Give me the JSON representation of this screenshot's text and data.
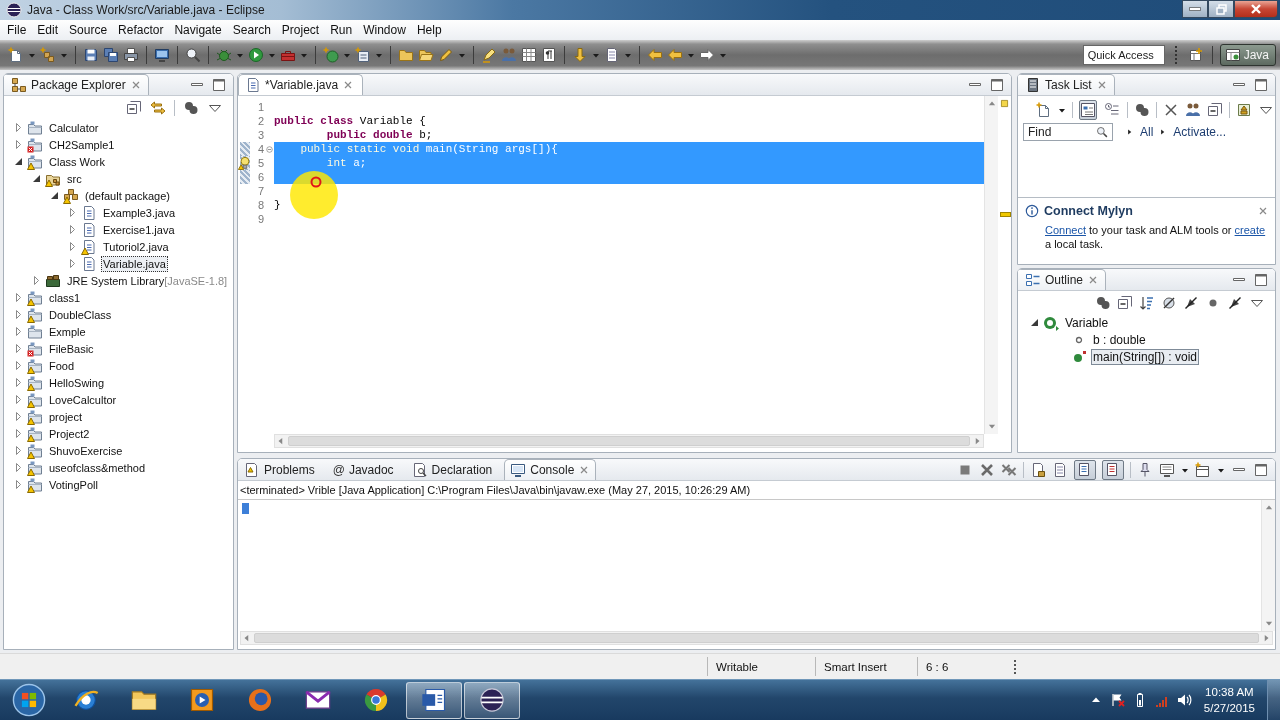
{
  "window": {
    "title": "Java - Class Work/src/Variable.java - Eclipse"
  },
  "menu": [
    "File",
    "Edit",
    "Source",
    "Refactor",
    "Navigate",
    "Search",
    "Project",
    "Run",
    "Window",
    "Help"
  ],
  "toolbar": {
    "quick_access": {
      "placeholder": "Quick Access"
    },
    "perspective": {
      "label": "Java",
      "selected": true
    }
  },
  "package_explorer": {
    "title": "Package Explorer",
    "tree": [
      {
        "label": "Calculator",
        "kind": "project",
        "warning": false,
        "error": false,
        "expanded": false,
        "selected": false
      },
      {
        "label": "CH2Sample1",
        "kind": "project",
        "warning": false,
        "error": true,
        "expanded": false,
        "selected": false
      },
      {
        "label": "Class Work",
        "kind": "project",
        "warning": true,
        "error": false,
        "expanded": true,
        "selected": false,
        "children": [
          {
            "label": "src",
            "kind": "source",
            "warning": true,
            "error": false,
            "expanded": true,
            "selected": false,
            "children": [
              {
                "label": "(default package)",
                "kind": "package",
                "warning": true,
                "error": false,
                "expanded": true,
                "selected": false,
                "children": [
                  {
                    "label": "Example3.java",
                    "kind": "file",
                    "warning": false,
                    "error": false,
                    "expanded": false,
                    "selected": false
                  },
                  {
                    "label": "Exercise1.java",
                    "kind": "file",
                    "warning": false,
                    "error": false,
                    "expanded": false,
                    "selected": false
                  },
                  {
                    "label": "Tutoriol2.java",
                    "kind": "file",
                    "warning": true,
                    "error": false,
                    "expanded": false,
                    "selected": false
                  },
                  {
                    "label": "Variable.java",
                    "kind": "file",
                    "warning": false,
                    "error": false,
                    "expanded": false,
                    "selected": true
                  }
                ]
              }
            ]
          },
          {
            "label": "JRE System Library",
            "suffix": "[JavaSE-1.8]",
            "kind": "library",
            "warning": false,
            "error": false,
            "expanded": false,
            "selected": false
          }
        ]
      },
      {
        "label": "class1",
        "kind": "project",
        "warning": true,
        "error": false,
        "expanded": false,
        "selected": false
      },
      {
        "label": "DoubleClass",
        "kind": "project",
        "warning": true,
        "error": false,
        "expanded": false,
        "selected": false
      },
      {
        "label": "Exmple",
        "kind": "project",
        "warning": false,
        "error": false,
        "expanded": false,
        "selected": false
      },
      {
        "label": "FileBasic",
        "kind": "project",
        "warning": false,
        "error": true,
        "expanded": false,
        "selected": false
      },
      {
        "label": "Food",
        "kind": "project",
        "warning": true,
        "error": false,
        "expanded": false,
        "selected": false
      },
      {
        "label": "HelloSwing",
        "kind": "project",
        "warning": true,
        "error": false,
        "expanded": false,
        "selected": false
      },
      {
        "label": "LoveCalcultor",
        "kind": "project",
        "warning": true,
        "error": false,
        "expanded": false,
        "selected": false
      },
      {
        "label": "project",
        "kind": "project",
        "warning": true,
        "error": false,
        "expanded": false,
        "selected": false
      },
      {
        "label": "Project2",
        "kind": "project",
        "warning": true,
        "error": false,
        "expanded": false,
        "selected": false
      },
      {
        "label": "ShuvoExercise",
        "kind": "project",
        "warning": true,
        "error": false,
        "expanded": false,
        "selected": false
      },
      {
        "label": "useofclass&method",
        "kind": "project",
        "warning": true,
        "error": false,
        "expanded": false,
        "selected": false
      },
      {
        "label": "VotingPoll",
        "kind": "project",
        "warning": true,
        "error": false,
        "expanded": false,
        "selected": false
      }
    ]
  },
  "editor": {
    "tabs": [
      {
        "label": "*Variable.java",
        "selected": true
      }
    ],
    "lines": [
      {
        "number": "1",
        "selected": false
      },
      {
        "number": "2",
        "code": "**public** **class** Variable {",
        "selected": false
      },
      {
        "number": "3",
        "code": "        **public** **double** b;",
        "selected": false
      },
      {
        "number": "4",
        "code": "    **public** **static** **void** main(String args[]){",
        "selected": true,
        "fold": true
      },
      {
        "number": "5",
        "code": "        **int** a;",
        "selected": true,
        "quick_fix": true
      },
      {
        "number": "6",
        "selected": true
      },
      {
        "number": "7",
        "selected": false
      },
      {
        "number": "8",
        "code": "}",
        "selected": false
      },
      {
        "number": "9",
        "selected": false
      }
    ]
  },
  "task_list": {
    "title": "Task List",
    "toggles": [
      {
        "kind": "categorized",
        "selected": true
      },
      {
        "kind": "scheduled",
        "selected": false
      }
    ],
    "find": {
      "placeholder": "Find"
    },
    "filters": [
      "All",
      "Activate..."
    ]
  },
  "mylyn": {
    "title": "Connect Mylyn",
    "message": [
      {
        "text": "Connect",
        "link": true
      },
      {
        "text": "to your task and ALM tools or",
        "link": false
      },
      {
        "text": "create",
        "link": true
      },
      {
        "text": "a local task.",
        "link": false
      }
    ]
  },
  "outline": {
    "title": "Outline",
    "tree": [
      {
        "label": "Variable",
        "kind": "class",
        "expanded": true,
        "selected": false,
        "children": [
          {
            "label": "b : double",
            "kind": "field",
            "selected": false
          },
          {
            "label": "main(String[]) : void",
            "kind": "method",
            "selected": true
          }
        ]
      }
    ]
  },
  "console": {
    "tabs": [
      {
        "label": "Problems",
        "kind": "problems",
        "selected": false
      },
      {
        "label": "Javadoc",
        "kind": "javadoc",
        "glyph": "@",
        "selected": false
      },
      {
        "label": "Declaration",
        "kind": "declaration",
        "selected": false
      },
      {
        "label": "Console",
        "kind": "console",
        "selected": true
      }
    ],
    "toggles": [
      {
        "kind": "stdout",
        "selected": true
      },
      {
        "kind": "stderr",
        "selected": true
      }
    ],
    "header": "<terminated> Vrible [Java Application] C:\\Program Files\\Java\\bin\\javaw.exe (May 27, 2015, 10:26:29 AM)"
  },
  "status_bar": [
    "Writable",
    "Smart Insert",
    "6 : 6"
  ],
  "taskbar": {
    "apps": [
      {
        "kind": "orbit",
        "open": false
      },
      {
        "kind": "folder",
        "open": false
      },
      {
        "kind": "player",
        "open": false
      },
      {
        "kind": "globe",
        "open": false
      },
      {
        "kind": "envelope",
        "open": false
      },
      {
        "kind": "pinwheel",
        "open": false
      },
      {
        "kind": "document",
        "open": true
      },
      {
        "kind": "orb",
        "open": true
      }
    ],
    "clock": {
      "time": "10:38 AM",
      "date": "5/27/2015"
    }
  }
}
